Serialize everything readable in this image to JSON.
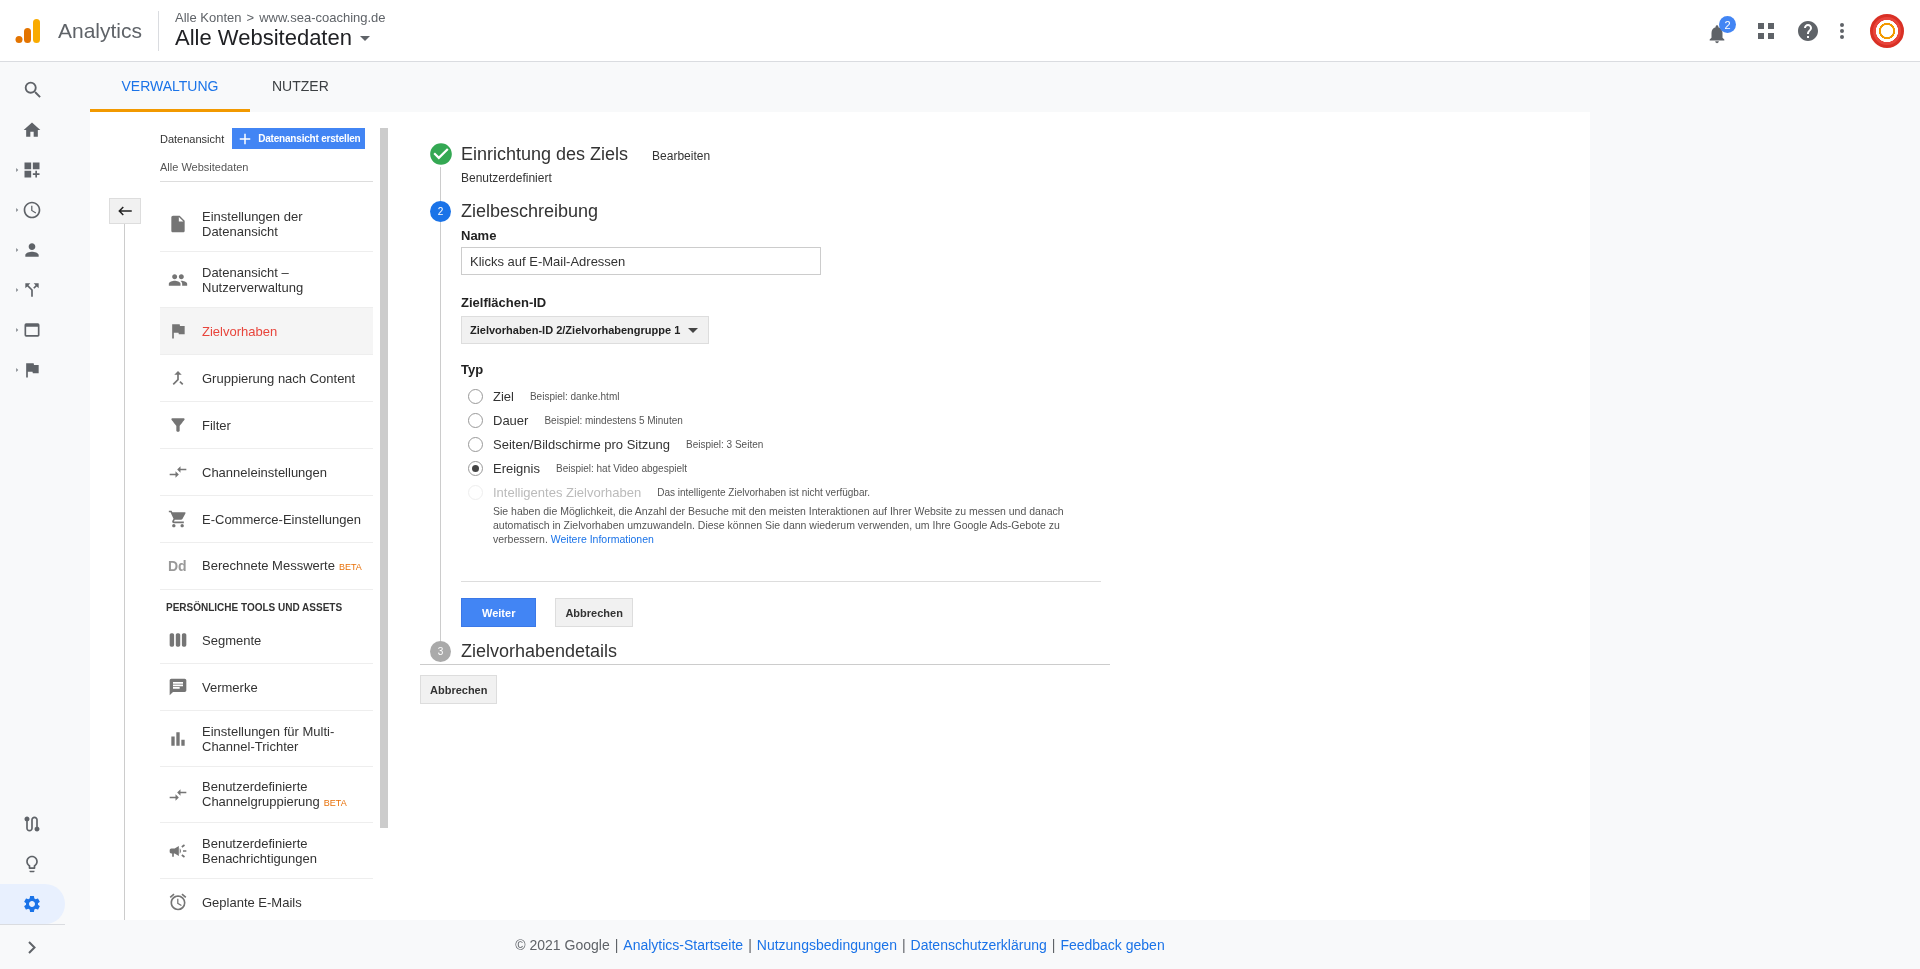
{
  "header": {
    "product": "Analytics",
    "breadcrumb_account": "Alle Konten",
    "breadcrumb_separator": ">",
    "breadcrumb_property": "www.sea-coaching.de",
    "view_name": "Alle Websitedaten",
    "notification_count": "2"
  },
  "rail": {
    "top": [
      {
        "expandable": false,
        "selected": false
      },
      {
        "expandable": true,
        "selected": false
      },
      {
        "expandable": true,
        "selected": false
      },
      {
        "expandable": true,
        "selected": false
      },
      {
        "expandable": true,
        "selected": false
      },
      {
        "expandable": true,
        "selected": false
      },
      {
        "expandable": true,
        "selected": false
      }
    ],
    "bottom": [
      {
        "selected": false
      },
      {
        "selected": false
      },
      {
        "selected": true
      }
    ]
  },
  "tabs": [
    {
      "label": "VERWALTUNG",
      "selected": true
    },
    {
      "label": "NUTZER",
      "selected": false
    }
  ],
  "admin": {
    "view_label": "Datenansicht",
    "create_button": "Datenansicht erstellen",
    "view_name": "Alle Websitedaten",
    "nav": [
      {
        "kind": "item",
        "label": "Einstellungen der Datenansicht",
        "selected": false
      },
      {
        "kind": "item",
        "label": "Datenansicht – Nutzerverwaltung",
        "selected": false
      },
      {
        "kind": "item",
        "label": "Zielvorhaben",
        "selected": true
      },
      {
        "kind": "item",
        "label": "Gruppierung nach Content",
        "selected": false
      },
      {
        "kind": "item",
        "label": "Filter",
        "selected": false
      },
      {
        "kind": "item",
        "label": "Channeleinstellungen",
        "selected": false
      },
      {
        "kind": "item",
        "label": "E-Commerce-Einstellungen",
        "selected": false
      },
      {
        "kind": "item",
        "label": "Berechnete Messwerte",
        "badge": "BETA",
        "icon_text": "Dd",
        "selected": false
      },
      {
        "kind": "heading",
        "label": "PERSÖNLICHE TOOLS UND ASSETS"
      },
      {
        "kind": "item",
        "label": "Segmente",
        "selected": false
      },
      {
        "kind": "item",
        "label": "Vermerke",
        "selected": false
      },
      {
        "kind": "item",
        "label": "Einstellungen für Multi-Channel-Trichter",
        "selected": false
      },
      {
        "kind": "item",
        "label": "Benutzerdefinierte Channelgruppierung",
        "badge": "BETA",
        "selected": false
      },
      {
        "kind": "item",
        "label": "Benutzerdefinierte Benachrichtigungen",
        "selected": false
      },
      {
        "kind": "item",
        "label": "Geplante E-Mails",
        "selected": false
      }
    ]
  },
  "form": {
    "steps": [
      {
        "kind": "done",
        "title": "Einrichtung des Ziels",
        "edit_link": "Bearbeiten",
        "summary": "Benutzerdefiniert"
      },
      {
        "kind": "active",
        "number": "2",
        "title": "Zielbeschreibung"
      },
      {
        "kind": "pending",
        "number": "3",
        "title": "Zielvorhabendetails"
      }
    ],
    "name_label": "Name",
    "name_value": "Klicks auf E-Mail-Adressen",
    "id_label": "Zielflächen-ID",
    "id_value": "Zielvorhaben-ID 2/Zielvorhabengruppe 1",
    "type_label": "Typ",
    "types": [
      {
        "label": "Ziel",
        "example": "Beispiel: danke.html",
        "selected": false,
        "disabled": false
      },
      {
        "label": "Dauer",
        "example": "Beispiel: mindestens 5 Minuten",
        "selected": false,
        "disabled": false
      },
      {
        "label": "Seiten/Bildschirme pro Sitzung",
        "example": "Beispiel: 3 Seiten",
        "selected": false,
        "disabled": false
      },
      {
        "label": "Ereignis",
        "example": "Beispiel: hat Video abgespielt",
        "selected": true,
        "disabled": false
      },
      {
        "label": "Intelligentes Zielvorhaben",
        "example": "Das intelligente Zielvorhaben ist nicht verfügbar.",
        "selected": false,
        "disabled": true
      }
    ],
    "smart_note": "Sie haben die Möglichkeit, die Anzahl der Besuche mit den meisten Interaktionen auf Ihrer Website zu messen und danach automatisch in Zielvorhaben umzuwandeln. Diese können Sie dann wiederum verwenden, um Ihre Google Ads-Gebote zu verbessern.",
    "smart_link": "Weitere Informationen",
    "continue_button": "Weiter",
    "cancel_button": "Abbrechen",
    "outer_cancel_button": "Abbrechen"
  },
  "footer": {
    "copyright": "© 2021 Google",
    "separator": "|",
    "links": [
      "Analytics-Startseite",
      "Nutzungsbedingungen",
      "Datenschutzerklärung",
      "Feedback geben"
    ]
  }
}
